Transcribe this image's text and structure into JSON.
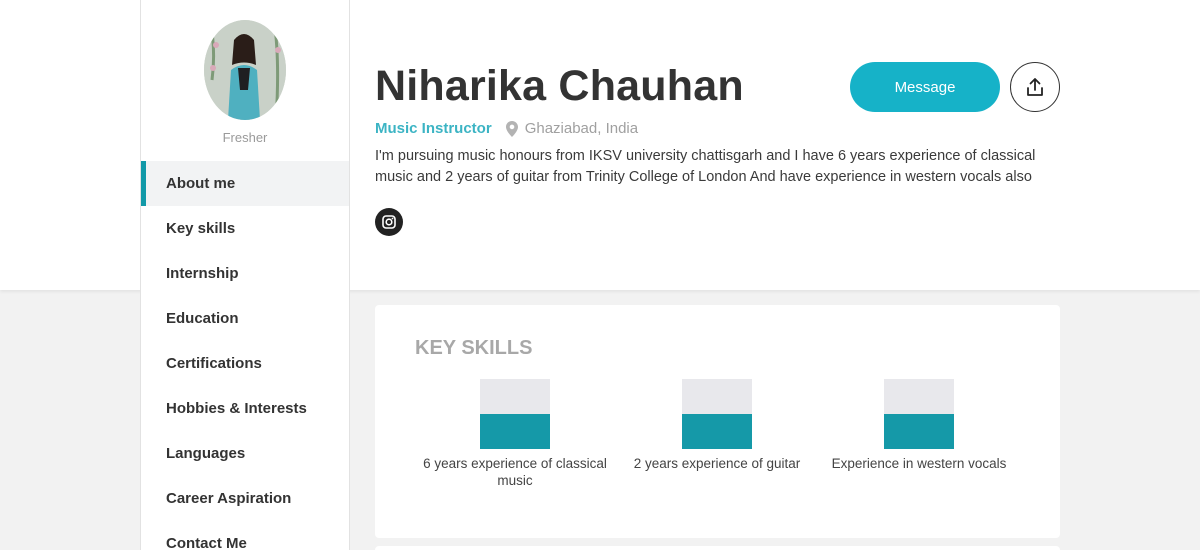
{
  "profile": {
    "name": "Niharika Chauhan",
    "status": "Fresher",
    "role": "Music Instructor",
    "location": "Ghaziabad, India",
    "bio": "I'm pursuing music honours from IKSV university chattisgarh and I have 6 years experience of classical music and 2 years of guitar from Trinity College of London And have experience in western vocals also"
  },
  "actions": {
    "message_label": "Message"
  },
  "sidebar": {
    "items": [
      {
        "label": "About me",
        "active": true
      },
      {
        "label": "Key skills"
      },
      {
        "label": "Internship"
      },
      {
        "label": "Education"
      },
      {
        "label": "Certifications"
      },
      {
        "label": "Hobbies & Interests"
      },
      {
        "label": "Languages"
      },
      {
        "label": "Career Aspiration"
      },
      {
        "label": "Contact Me"
      }
    ]
  },
  "key_skills": {
    "title": "KEY SKILLS",
    "skills": [
      {
        "label": "6 years experience of classical music",
        "level": 0.5
      },
      {
        "label": "2 years experience of guitar",
        "level": 0.5
      },
      {
        "label": "Experience in western vocals",
        "level": 0.5
      }
    ]
  },
  "colors": {
    "accent": "#16b2c8",
    "skill_fill": "#1599a8",
    "role_text": "#3cb4c4"
  },
  "icons": {
    "location": "map-pin-icon",
    "share": "share-upload-icon",
    "social": "instagram-icon"
  }
}
